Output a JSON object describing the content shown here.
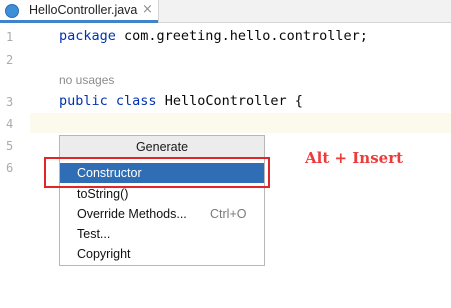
{
  "tab": {
    "filename": "HelloController.java",
    "close_glyph": "×",
    "icon": "java-class-icon"
  },
  "gutter": {
    "line_numbers": [
      "1",
      "2",
      "3",
      "4",
      "5",
      "6"
    ]
  },
  "code": {
    "line1_keyword": "package",
    "line1_rest": " com.greeting.hello.controller;",
    "usage_hint": "no usages",
    "line3_keyword1": "public",
    "line3_keyword2": "class",
    "line3_rest": " HelloController {"
  },
  "popup": {
    "title": "Generate",
    "items": [
      {
        "label": "Constructor",
        "shortcut": "",
        "selected": true
      },
      {
        "label": "toString()",
        "shortcut": ""
      },
      {
        "label": "Override Methods...",
        "shortcut": "Ctrl+O"
      },
      {
        "label": "Test...",
        "shortcut": ""
      },
      {
        "label": "Copyright",
        "shortcut": ""
      }
    ]
  },
  "annotation": {
    "text": "Alt + Insert"
  },
  "colors": {
    "keyword": "#0033b3",
    "selection": "#2f6db4",
    "annotation_red": "#e0262b",
    "tab_underline": "#4083c9"
  }
}
